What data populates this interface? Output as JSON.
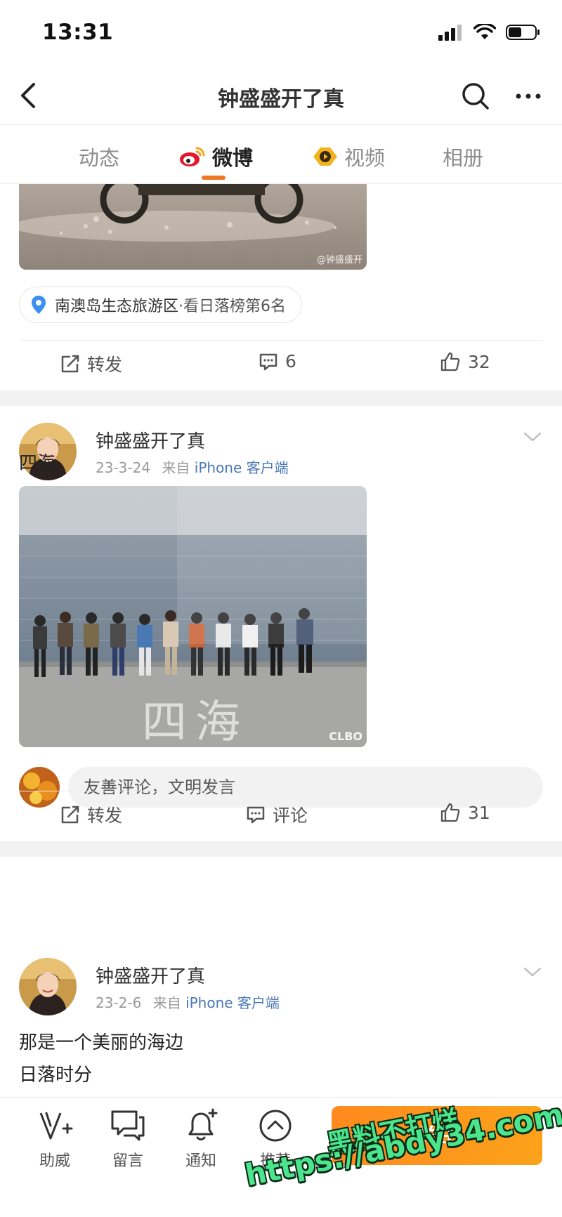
{
  "status": {
    "time": "13:31"
  },
  "nav": {
    "title": "钟盛盛开了真"
  },
  "tabs": [
    {
      "label": "动态",
      "active": false
    },
    {
      "label": "微博",
      "active": true
    },
    {
      "label": "视频",
      "active": false
    },
    {
      "label": "相册",
      "active": false
    }
  ],
  "accent_color": "#f07823",
  "feed": {
    "partial_post": {
      "photo_watermark": "@钟盛盛开",
      "location": {
        "main": "南澳岛生态旅游区",
        "rank": "·看日落榜第6名"
      },
      "actions": {
        "repost": "转发",
        "comments": "6",
        "likes": "32"
      }
    },
    "posts": [
      {
        "author": "钟盛盛开了真",
        "date": "23-3-24",
        "via_prefix": "来自",
        "via_source": "iPhone 客户端",
        "text": "四海",
        "photo_caption": "四海",
        "photo_logo": "CLBO",
        "comment_placeholder": "友善评论，文明发言",
        "actions": {
          "repost": "转发",
          "comment": "评论",
          "likes": "31"
        }
      },
      {
        "author": "钟盛盛开了真",
        "date": "23-2-6",
        "via_prefix": "来自",
        "via_source": "iPhone 客户端",
        "text_lines": [
          "那是一个美丽的海边",
          "日落时分"
        ]
      }
    ]
  },
  "bottom_bar": {
    "items": [
      {
        "label": "助威",
        "icon": "cheer-icon"
      },
      {
        "label": "留言",
        "icon": "message-icon"
      },
      {
        "label": "通知",
        "icon": "bell-icon"
      },
      {
        "label": "推荐",
        "icon": "recommend-icon"
      }
    ],
    "follow_label": "关注"
  },
  "watermark": {
    "line1": "黑料不打烊",
    "line2": "https://abdy34.com"
  }
}
